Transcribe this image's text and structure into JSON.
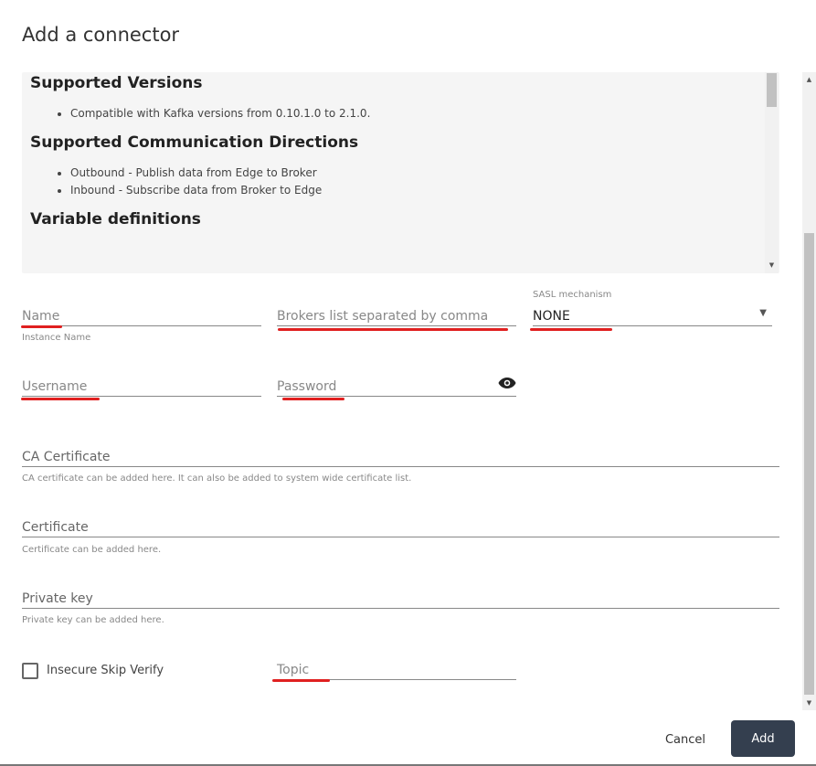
{
  "dialog": {
    "title": "Add a connector"
  },
  "description": {
    "sections": [
      {
        "heading": "Supported Versions",
        "items": [
          "Compatible with Kafka versions from 0.10.1.0 to 2.1.0."
        ]
      },
      {
        "heading": "Supported Communication Directions",
        "items": [
          "Outbound - Publish data from Edge to Broker",
          "Inbound - Subscribe data from Broker to Edge"
        ]
      },
      {
        "heading": "Variable definitions",
        "items": []
      }
    ]
  },
  "form": {
    "name": {
      "placeholder": "Name",
      "help": "Instance Name"
    },
    "brokers": {
      "placeholder": "Brokers list separated by comma"
    },
    "sasl": {
      "label": "SASL mechanism",
      "value": "NONE"
    },
    "username": {
      "placeholder": "Username"
    },
    "password": {
      "placeholder": "Password",
      "icon": "eye-icon"
    },
    "ca_cert": {
      "placeholder": "CA Certificate",
      "help": "CA certificate can be added here. It can also be added to system wide certificate list."
    },
    "cert": {
      "placeholder": "Certificate",
      "help": "Certificate can be added here."
    },
    "private_key": {
      "placeholder": "Private key",
      "help": "Private key can be added here."
    },
    "insecure": {
      "label": "Insecure Skip Verify",
      "checked": false
    },
    "topic": {
      "placeholder": "Topic"
    }
  },
  "actions": {
    "cancel": "Cancel",
    "add": "Add"
  },
  "colors": {
    "primary_button": "#343f4f",
    "annotation": "#e02020"
  }
}
